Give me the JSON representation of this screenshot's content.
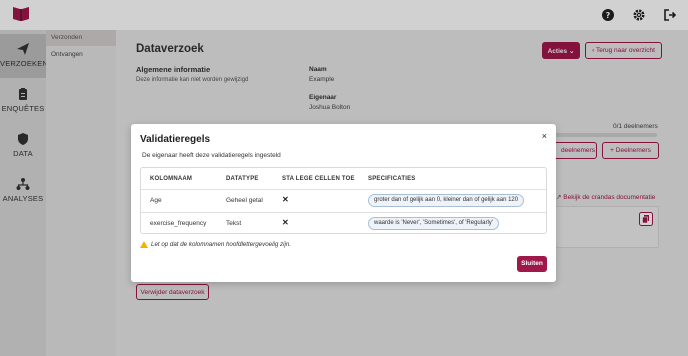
{
  "brand": {
    "accent": "#a0174a",
    "warning": "#f0b400"
  },
  "topbar": {
    "icons": [
      "book-logo-icon",
      "help-icon",
      "gear-icon",
      "logout-icon"
    ]
  },
  "rail": {
    "items": [
      {
        "label": "VERZOEKEN",
        "icon": "paper-plane-icon",
        "active": true
      },
      {
        "label": "ENQUÊTES",
        "icon": "clipboard-icon",
        "active": false
      },
      {
        "label": "DATA",
        "icon": "shield-icon",
        "active": false
      },
      {
        "label": "ANALYSES",
        "icon": "network-icon",
        "active": false
      }
    ]
  },
  "subnav": {
    "items": [
      {
        "label": "Verzonden",
        "active": true
      },
      {
        "label": "Ontvangen",
        "active": false
      }
    ]
  },
  "main": {
    "title": "Dataverzoek",
    "actions_label": "Acties",
    "back_label": "Terug naar overzicht",
    "info_title": "Algemene informatie",
    "info_sub": "Deze informatie kan niet worden gewijzigd",
    "name_label": "Naam",
    "name_value": "Example",
    "owner_label": "Eigenaar",
    "owner_value": "Joshua Bolton",
    "participants_count": "0/1 deelnemers",
    "participants_progress": 0,
    "participants_btn_partial": "deelnemers",
    "add_participants_label": "Deelnemers",
    "docs_link": "Bekijk de crandas documentatie",
    "delete_label": "Verwijder dataverzoek"
  },
  "modal": {
    "title": "Validatieregels",
    "close_symbol": "×",
    "subtitle": "De eigenaar heeft deze validatieregels ingesteld",
    "columns": [
      "KOLOMNAAM",
      "DATATYPE",
      "STA LEGE CELLEN TOE",
      "SPECIFICATIES"
    ],
    "rows": [
      {
        "name": "Age",
        "type": "Geheel getal",
        "allow_empty": "✕",
        "spec": "groter dan of gelijk aan 0, kleiner dan of gelijk aan 120"
      },
      {
        "name": "exercise_frequency",
        "type": "Tekst",
        "allow_empty": "✕",
        "spec": "waarde is 'Never', 'Sometimes', of 'Regularly'"
      }
    ],
    "note": "Let op dat de kolomnamen hoofdlettergevoelig zijn.",
    "close_label": "Sluiten"
  }
}
